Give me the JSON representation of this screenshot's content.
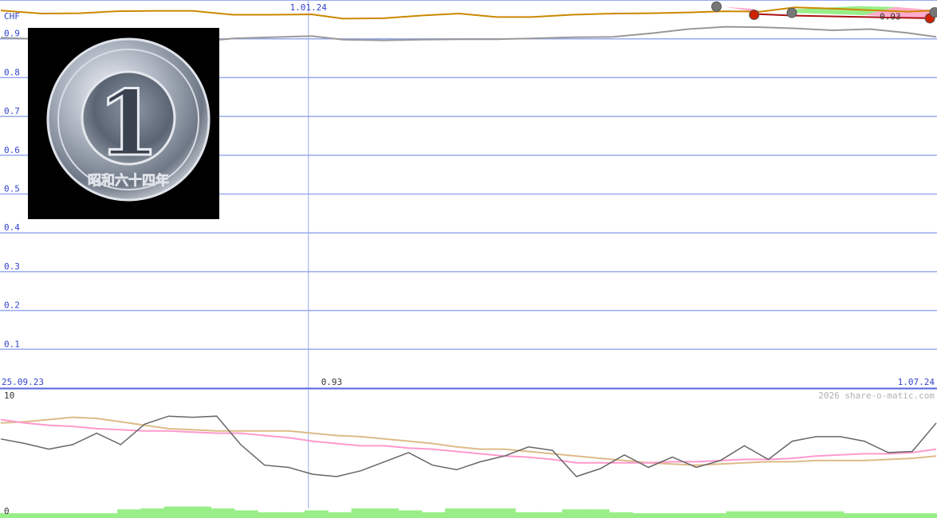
{
  "chart_data": [
    {
      "type": "line",
      "title": "",
      "ylabel": "CHF",
      "xlabel": "",
      "ylim": [
        0,
        1.0
      ],
      "y_ticks": [
        0.1,
        0.2,
        0.3,
        0.4,
        0.5,
        0.6,
        0.7,
        0.8,
        0.9
      ],
      "x_range": [
        "2023-09-25",
        "2024-07-19"
      ],
      "x_tick_labels": [
        {
          "date": "2023-09-25",
          "label": "25.09.23"
        },
        {
          "date": "2024-01-01",
          "label": "1.01.24"
        },
        {
          "date": "2024-07-01",
          "label": "1.07.24"
        }
      ],
      "grid": true,
      "series": [
        {
          "color": "#cc8800",
          "points": [
            [
              "2023-09-25",
              0.973
            ],
            [
              "2023-10-08",
              0.965
            ],
            [
              "2023-10-20",
              0.966
            ],
            [
              "2023-11-01",
              0.971
            ],
            [
              "2023-11-13",
              0.972
            ],
            [
              "2023-11-25",
              0.972
            ],
            [
              "2023-12-08",
              0.962
            ],
            [
              "2023-12-20",
              0.962
            ],
            [
              "2024-01-02",
              0.963
            ],
            [
              "2024-01-12",
              0.952
            ],
            [
              "2024-01-25",
              0.953
            ],
            [
              "2024-02-06",
              0.96
            ],
            [
              "2024-02-18",
              0.965
            ],
            [
              "2024-03-01",
              0.956
            ],
            [
              "2024-03-12",
              0.956
            ],
            [
              "2024-03-25",
              0.962
            ],
            [
              "2024-04-07",
              0.965
            ],
            [
              "2024-04-19",
              0.966
            ],
            [
              "2024-05-01",
              0.968
            ],
            [
              "2024-05-13",
              0.971
            ],
            [
              "2024-05-24",
              0.97
            ],
            [
              "2024-06-04",
              0.981
            ],
            [
              "2024-06-16",
              0.978
            ],
            [
              "2024-06-28",
              0.974
            ],
            [
              "2024-07-10",
              0.97
            ],
            [
              "2024-07-19",
              0.973
            ]
          ]
        },
        {
          "color": "#999999",
          "points": [
            [
              "2023-09-25",
              0.903
            ],
            [
              "2023-10-08",
              0.899
            ],
            [
              "2023-10-20",
              0.891
            ],
            [
              "2023-11-01",
              0.902
            ],
            [
              "2023-11-13",
              0.897
            ],
            [
              "2023-11-25",
              0.891
            ],
            [
              "2023-12-08",
              0.901
            ],
            [
              "2023-12-20",
              0.904
            ],
            [
              "2024-01-02",
              0.907
            ],
            [
              "2024-01-12",
              0.898
            ],
            [
              "2024-01-25",
              0.896
            ],
            [
              "2024-02-06",
              0.898
            ],
            [
              "2024-02-18",
              0.899
            ],
            [
              "2024-03-01",
              0.899
            ],
            [
              "2024-03-12",
              0.901
            ],
            [
              "2024-03-25",
              0.904
            ],
            [
              "2024-04-07",
              0.905
            ],
            [
              "2024-04-19",
              0.914
            ],
            [
              "2024-05-01",
              0.925
            ],
            [
              "2024-05-13",
              0.931
            ],
            [
              "2024-05-24",
              0.93
            ],
            [
              "2024-06-04",
              0.927
            ],
            [
              "2024-06-16",
              0.922
            ],
            [
              "2024-06-28",
              0.925
            ],
            [
              "2024-07-10",
              0.915
            ],
            [
              "2024-07-19",
              0.905
            ]
          ]
        },
        {
          "color": "#aa1111",
          "points": [
            [
              "2024-05-22",
              0.964
            ],
            [
              "2024-06-03",
              0.96
            ],
            [
              "2024-07-17",
              0.953
            ]
          ]
        }
      ],
      "fills": [
        {
          "color": "#ffaacc",
          "points": [
            [
              "2024-05-10",
              0.984
            ],
            [
              "2024-05-22",
              0.977
            ],
            [
              "2024-05-22",
              0.97
            ],
            [
              "2024-05-13",
              0.982
            ]
          ]
        },
        {
          "color": "#99ee88",
          "points": [
            [
              "2024-06-03",
              0.976
            ],
            [
              "2024-06-24",
              0.984
            ],
            [
              "2024-07-06",
              0.982
            ],
            [
              "2024-06-26",
              0.961
            ],
            [
              "2024-06-03",
              0.967
            ]
          ]
        },
        {
          "color": "#ffaacc",
          "points": [
            [
              "2024-07-06",
              0.982
            ],
            [
              "2024-07-17",
              0.975
            ],
            [
              "2024-07-17",
              0.953
            ],
            [
              "2024-06-26",
              0.961
            ]
          ]
        }
      ],
      "markers": [
        {
          "date": "2024-05-10",
          "value": 0.983,
          "color": "#777777"
        },
        {
          "date": "2024-05-22",
          "value": 0.962,
          "color": "#cc2200"
        },
        {
          "date": "2024-06-03",
          "value": 0.967,
          "color": "#777777"
        },
        {
          "date": "2024-07-17",
          "value": 0.953,
          "color": "#cc2200"
        },
        {
          "date": "2024-07-21",
          "value": 0.968,
          "color": "#777777"
        }
      ],
      "annotations": [
        {
          "text": "0.93",
          "date": "2024-07-01",
          "value": 0.958
        },
        {
          "text": "0.93",
          "date": "2024-01-02",
          "value": 0.0,
          "where": "below-axis"
        }
      ]
    },
    {
      "type": "line",
      "title": "",
      "ylim": [
        0,
        10
      ],
      "y_tick_labels": [
        "10",
        "0"
      ],
      "x_range": [
        "2023-09-25",
        "2024-07-19"
      ],
      "series": [
        {
          "color": "#666666",
          "values": [
            6.1,
            5.7,
            5.2,
            5.6,
            6.6,
            5.6,
            7.4,
            8.1,
            8.0,
            8.1,
            5.6,
            3.8,
            3.6,
            3.0,
            2.8,
            3.3,
            4.1,
            4.9,
            3.8,
            3.4,
            4.1,
            4.6,
            5.4,
            5.1,
            2.8,
            3.5,
            4.7,
            3.6,
            4.5,
            3.6,
            4.2,
            5.5,
            4.3,
            5.9,
            6.3,
            6.3,
            5.9,
            4.9,
            5.0,
            7.5
          ]
        },
        {
          "color": "#ff99cc",
          "values": [
            7.8,
            7.5,
            7.3,
            7.2,
            7.0,
            6.9,
            6.8,
            6.8,
            6.7,
            6.6,
            6.6,
            6.4,
            6.2,
            5.9,
            5.7,
            5.5,
            5.5,
            5.3,
            5.2,
            5.0,
            4.8,
            4.6,
            4.5,
            4.3,
            4.0,
            4.0,
            4.0,
            4.0,
            4.1,
            4.1,
            4.2,
            4.3,
            4.3,
            4.4,
            4.6,
            4.7,
            4.8,
            4.8,
            4.9,
            5.2
          ]
        },
        {
          "color": "#ddbb88",
          "values": [
            7.5,
            7.6,
            7.8,
            8.0,
            7.9,
            7.6,
            7.3,
            7.0,
            6.9,
            6.8,
            6.8,
            6.8,
            6.8,
            6.6,
            6.4,
            6.3,
            6.1,
            5.9,
            5.7,
            5.4,
            5.2,
            5.2,
            5.0,
            4.8,
            4.6,
            4.4,
            4.2,
            4.0,
            3.9,
            3.8,
            3.9,
            4.0,
            4.1,
            4.1,
            4.2,
            4.2,
            4.2,
            4.3,
            4.4,
            4.6
          ]
        }
      ],
      "volume_color": "#99ee88",
      "volume": [
        0.5,
        0.5,
        0.5,
        0.5,
        0.5,
        0.9,
        1.0,
        1.2,
        1.2,
        1.0,
        0.8,
        0.6,
        0.6,
        0.8,
        0.6,
        1.0,
        1.0,
        0.8,
        0.6,
        1.0,
        1.0,
        1.0,
        0.6,
        0.6,
        0.9,
        0.9,
        0.6,
        0.5,
        0.5,
        0.5,
        0.5,
        0.7,
        0.7,
        0.7,
        0.7,
        0.7,
        0.5,
        0.5,
        0.5,
        0.5
      ]
    }
  ],
  "copyright": "2026 share-o-matic.com",
  "coin_image": {
    "icon": "one-yen-coin-photo",
    "face_text": "1",
    "rim_text": "昭和六十四年"
  }
}
